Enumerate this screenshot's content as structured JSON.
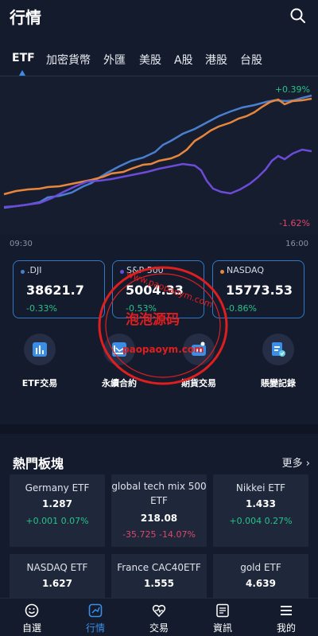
{
  "header": {
    "title": "行情"
  },
  "tabs": [
    {
      "label": "ETF",
      "active": true
    },
    {
      "label": "加密貨幣"
    },
    {
      "label": "外匯"
    },
    {
      "label": "美股"
    },
    {
      "label": "A股"
    },
    {
      "label": "港股"
    },
    {
      "label": "台股"
    }
  ],
  "chart": {
    "top_label": "+0.39%",
    "bottom_label": "-1.62%",
    "time_start": "09:30",
    "time_end": "16:00",
    "colors": {
      "blue_line": "#4a7fd0",
      "orange_line": "#e8873c",
      "purple_line": "#6b4bd8"
    }
  },
  "indices": [
    {
      "name": ".DJI",
      "value": "38621.7",
      "change": "-0.33%",
      "dot_color": "#4a7fd0"
    },
    {
      "name": "S&P 500",
      "value": "5004.33",
      "change": "-0.53%",
      "dot_color": "#6b4bd8"
    },
    {
      "name": "NASDAQ",
      "value": "15773.53",
      "change": "-0.86%",
      "dot_color": "#e8873c"
    }
  ],
  "quick_actions": [
    {
      "label": "ETF交易",
      "icon": "etf-chart-icon"
    },
    {
      "label": "永續合約",
      "icon": "contract-icon"
    },
    {
      "label": "期貨交易",
      "icon": "futures-icon"
    },
    {
      "label": "賬變記錄",
      "icon": "record-icon"
    }
  ],
  "hot": {
    "title": "熱門板塊",
    "more": "更多 ›",
    "cards": [
      {
        "name": "Germany ETF",
        "price": "1.287",
        "change": "+0.001  0.07%",
        "direction": "up"
      },
      {
        "name": "global tech mix 500 ETF",
        "price": "218.08",
        "change": "-35.725  -14.07%",
        "direction": "down"
      },
      {
        "name": "Nikkei ETF",
        "price": "1.433",
        "change": "+0.004  0.27%",
        "direction": "up"
      },
      {
        "name": "NASDAQ ETF",
        "price": "1.627",
        "change": "",
        "direction": "up"
      },
      {
        "name": "France CAC40ETF",
        "price": "1.555",
        "change": "",
        "direction": "down"
      },
      {
        "name": "gold ETF",
        "price": "4.639",
        "change": "",
        "direction": "up"
      }
    ]
  },
  "watermark": {
    "line1": "www.paopaoym.com",
    "line2": "泡泡源码",
    "line3": "paopaoym.com"
  },
  "bottom_nav": [
    {
      "label": "自選",
      "icon": "smile-icon"
    },
    {
      "label": "行情",
      "icon": "market-icon",
      "active": true
    },
    {
      "label": "交易",
      "icon": "trade-icon"
    },
    {
      "label": "資訊",
      "icon": "news-icon"
    },
    {
      "label": "我的",
      "icon": "menu-icon"
    }
  ]
}
